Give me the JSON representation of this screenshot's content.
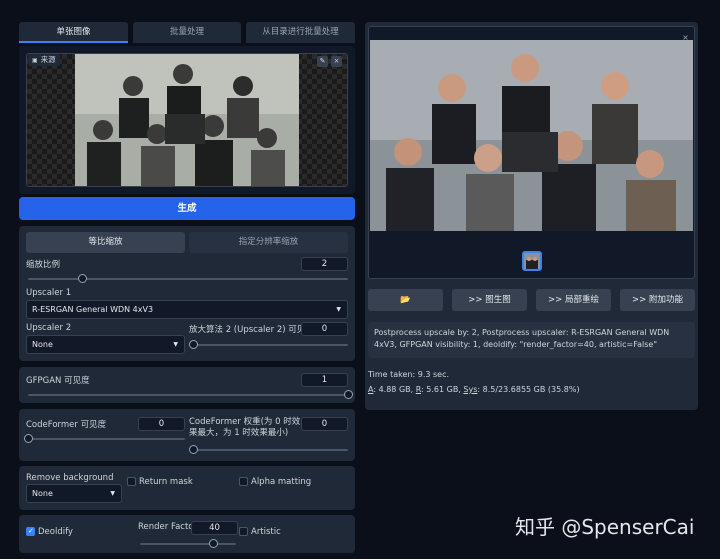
{
  "tabs": [
    {
      "label": "单张图像"
    },
    {
      "label": "批量处理"
    },
    {
      "label": "从目录进行批量处理"
    }
  ],
  "source": {
    "label": "来源",
    "image_desc": "black-and-white group photo of nine people"
  },
  "generate_label": "生成",
  "scale_tabs": [
    {
      "label": "等比缩放"
    },
    {
      "label": "指定分辨率缩放"
    }
  ],
  "scale": {
    "label": "缩放比例",
    "value": "2",
    "fraction": 0.17
  },
  "upscaler1": {
    "label": "Upscaler 1",
    "value": "R-ESRGAN General WDN 4xV3"
  },
  "upscaler2": {
    "label": "Upscaler 2",
    "value": "None"
  },
  "upscaler2_vis": {
    "label": "放大算法 2 (Upscaler 2) 可见度",
    "value": "0",
    "fraction": 0.0
  },
  "gfpgan": {
    "label": "GFPGAN 可见度",
    "value": "1",
    "fraction": 1.0
  },
  "codeformer": {
    "label": "CodeFormer 可见度",
    "value": "0",
    "fraction": 0.0
  },
  "codeformer_weight": {
    "label": "CodeFormer 权重(为 0 时效果最大，为 1 时效果最小)",
    "value": "0",
    "fraction": 0.0
  },
  "remove_bg": {
    "label": "Remove background",
    "value": "None"
  },
  "return_mask": {
    "label": "Return mask"
  },
  "alpha_matting": {
    "label": "Alpha matting"
  },
  "deoldify": {
    "label": "Deoldify"
  },
  "render_factor": {
    "label": "Render Factor",
    "value": "40",
    "fraction": 0.77
  },
  "artistic": {
    "label": "Artistic"
  },
  "output": {
    "image_desc": "colorized group photo of nine people"
  },
  "actions": [
    {
      "label": "📂",
      "icon": "folder-icon"
    },
    {
      "label": ">> 图生图"
    },
    {
      "label": ">> 局部重绘"
    },
    {
      "label": ">> 附加功能"
    }
  ],
  "info_text": "Postprocess upscale by: 2, Postprocess upscaler: R-ESRGAN General WDN 4xV3, GFPGAN visibility: 1, deoldify: \"render_factor=40, artistic=False\"",
  "time_taken": "Time taken: 9.3 sec.",
  "mem_a": "A",
  "mem_a_val": ": 4.88 GB, ",
  "mem_r": "R",
  "mem_r_val": ": 5.61 GB, ",
  "mem_sys": "Sys",
  "mem_sys_val": ": 8.5/23.6855 GB (35.8%)",
  "watermark": "知乎 @SpenserCai",
  "colors": {
    "accent": "#2563eb",
    "panel": "#1f2937",
    "background": "#0b0f19"
  }
}
